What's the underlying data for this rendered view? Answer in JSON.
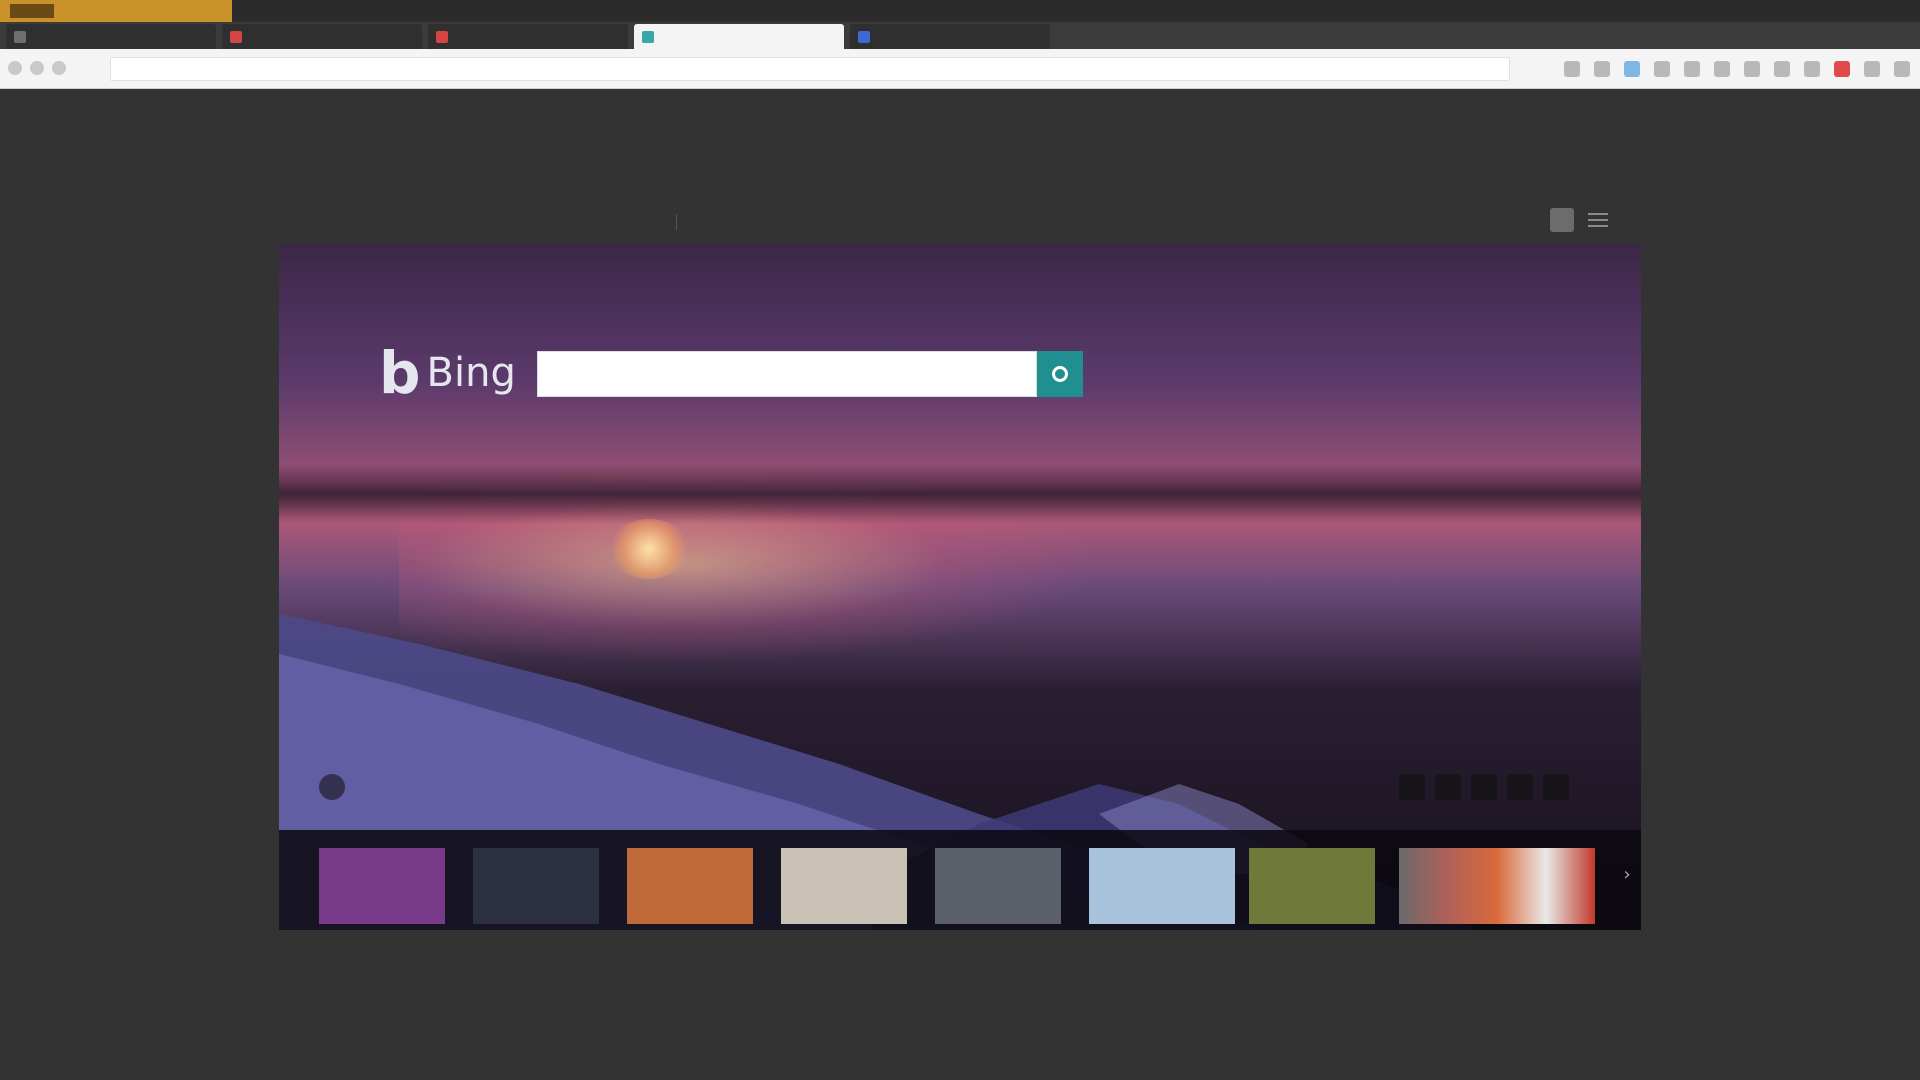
{
  "browser": {
    "bookmarks": [
      "",
      "",
      "",
      "",
      "",
      "",
      "",
      ""
    ],
    "tabs": [
      {
        "label": "",
        "favicon_color": "#6f6f6f",
        "active": false
      },
      {
        "label": "",
        "favicon_color": "#d64545",
        "active": false
      },
      {
        "label": "",
        "favicon_color": "#d64545",
        "active": false
      },
      {
        "label": "",
        "favicon_color": "#3aa6a6",
        "active": true
      },
      {
        "label": "",
        "favicon_color": "#3a6ad6",
        "active": false
      }
    ],
    "url": "",
    "url_secondary": ""
  },
  "bing": {
    "nav": [
      {
        "label": "",
        "active": true
      },
      {
        "label": "",
        "active": false
      },
      {
        "label": "",
        "active": false
      },
      {
        "label": "",
        "active": false
      },
      {
        "label": "",
        "active": false
      },
      {
        "label": "",
        "active": false
      },
      {
        "label": "",
        "active": false
      },
      {
        "label": "",
        "active": false
      }
    ],
    "signin": "",
    "logo_text": "Bing",
    "search": {
      "value": "",
      "placeholder": ""
    },
    "trending": [
      "",
      "",
      "",
      "",
      "",
      "",
      "",
      "",
      "",
      ""
    ],
    "carousel": [
      {
        "label": "",
        "color": "#7a3a8a"
      },
      {
        "label": "",
        "color": "#2c3040"
      },
      {
        "label": "",
        "color": "#c06a3a"
      },
      {
        "label": "",
        "color": "#c9c2b4"
      },
      {
        "label": "",
        "color": "#5a5f6a"
      },
      {
        "label": "",
        "color": "#a9c3dc"
      },
      {
        "label": "",
        "color": "#6f7a3a"
      },
      {
        "label": "",
        "color": "#b0605a"
      }
    ],
    "footer": {
      "copyright": "",
      "links": [
        "",
        "",
        "",
        "",
        "",
        ""
      ]
    }
  },
  "colors": {
    "page_bg": "#333333",
    "accent": "#1f8f8f",
    "brand_bar": "#c8912a"
  },
  "icons": [
    "back-icon",
    "forward-icon",
    "refresh-icon",
    "search-icon",
    "menu-icon",
    "rewards-icon",
    "location-icon",
    "chevron-right-icon"
  ]
}
